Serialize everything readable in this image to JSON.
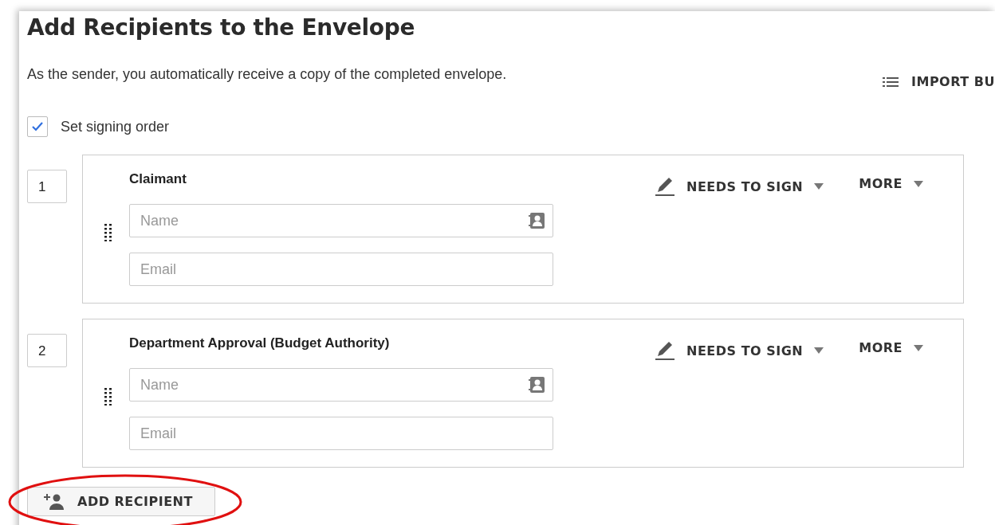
{
  "title": "Add Recipients to the Envelope",
  "subtitle": "As the sender, you automatically receive a copy of the completed envelope.",
  "import_button": {
    "label": "IMPORT BU"
  },
  "signing_order": {
    "label": "Set signing order",
    "checked": true
  },
  "recipients": [
    {
      "order": "1",
      "role_title": "Claimant",
      "name_placeholder": "Name",
      "email_placeholder": "Email",
      "action": "NEEDS TO SIGN",
      "more": "MORE"
    },
    {
      "order": "2",
      "role_title": "Department Approval (Budget Authority)",
      "name_placeholder": "Name",
      "email_placeholder": "Email",
      "action": "NEEDS TO SIGN",
      "more": "MORE"
    }
  ],
  "add_button": {
    "label": "ADD RECIPIENT",
    "highlighted": true
  }
}
